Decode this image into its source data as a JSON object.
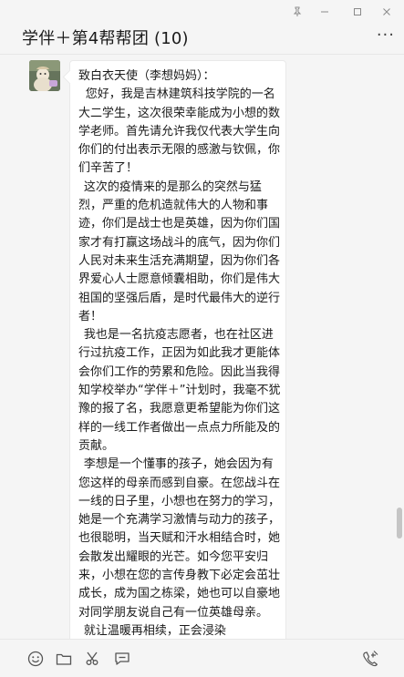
{
  "window": {
    "title": "学伴＋第4帮帮团 (10)",
    "more_label": "···",
    "controls": [
      "pin-icon",
      "minimize-icon",
      "maximize-icon",
      "close-icon"
    ]
  },
  "message": {
    "sender_avatar": "avatar",
    "greeting": "致白衣天使（李想妈妈）：",
    "paragraphs": [
      "您好，我是吉林建筑科技学院的一名大二学生，这次很荣幸能成为小想的数学老师。首先请允许我仅代表大学生向你们的付出表示无限的感激与钦佩，你们辛苦了！",
      "这次的疫情来的是那么的突然与猛烈，严重的危机造就伟大的人物和事迹，你们是战士也是英雄，因为你们国家才有打赢这场战斗的底气，因为你们人民对未来生活充满期望，因为你们各界爱心人士愿意倾囊相助，你们是伟大祖国的坚强后盾，是时代最伟大的逆行者！",
      "我也是一名抗疫志愿者，也在社区进行过抗疫工作，正因为如此我才更能体会你们工作的劳累和危险。因此当我得知学校举办“学伴＋”计划时，我毫不犹豫的报了名，我愿意更希望能为你们这样的一线工作者做出一点点力所能及的贡献。",
      "李想是一个懂事的孩子，她会因为有您这样的母亲而感到自豪。在您战斗在一线的日子里，小想也在努力的学习，她是一个充满学习激情与动力的孩子，也很聪明，当天赋和汗水相结合时，她会散发出耀眼的光芒。如今您平安归来，小想在您的言传身教下必定会茁壮成长，成为国之栋梁，她也可以自豪地对同学朋友说自己有一位英雄母亲。",
      "就让温暖再相续，正会浸染"
    ]
  },
  "toolbar": {
    "icons": [
      "emoji-icon",
      "folder-icon",
      "scissors-icon",
      "chat-history-icon",
      "voice-call-icon"
    ]
  },
  "colors": {
    "background": "#f5f5f5",
    "bubble": "#ffffff",
    "text": "#1b1b1b"
  }
}
